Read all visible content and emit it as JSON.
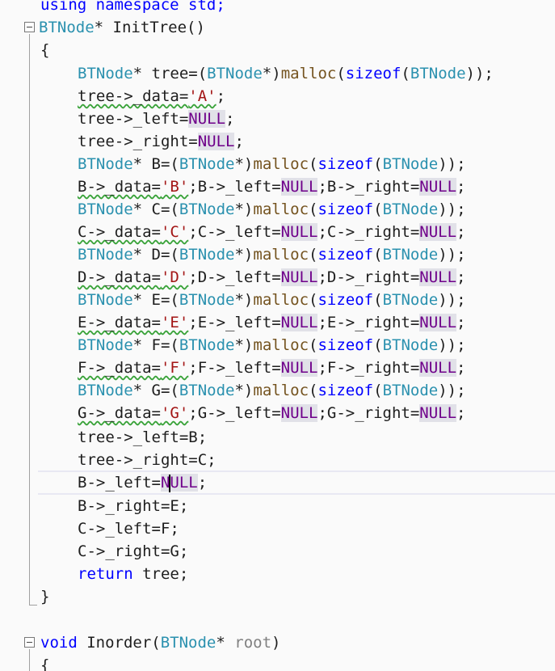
{
  "lines": {
    "l0": "using namespace std;",
    "l1_ty": "BTNode",
    "l1_rest": "* InitTree()",
    "l2": "{",
    "l3a": "BTNode",
    "l3b": "* tree=(",
    "l3c": "BTNode",
    "l3d": "*)",
    "l3e": "malloc",
    "l3f": "(",
    "l3g": "sizeof",
    "l3h": "(",
    "l3i": "BTNode",
    "l3j": "));",
    "l4a": "tree->_data=",
    "l4b": "'A'",
    "l4c": ";",
    "l5a": "tree->_left=",
    "l5b": "NULL",
    "l5c": ";",
    "l6a": "tree->_right=",
    "l6b": "NULL",
    "l6c": ";",
    "rows": [
      {
        "v": "B",
        "ch": "'B'"
      },
      {
        "v": "C",
        "ch": "'C'"
      },
      {
        "v": "D",
        "ch": "'D'"
      },
      {
        "v": "E",
        "ch": "'E'"
      },
      {
        "v": "F",
        "ch": "'F'"
      },
      {
        "v": "G",
        "ch": "'G'"
      }
    ],
    "t1": "tree->_left=B;",
    "t2": "tree->_right=C;",
    "t3a": "B->_left=",
    "t3b": "NULL",
    "t3c": ";",
    "t4": "B->_right=E;",
    "t5": "C->_left=F;",
    "t6": "C->_right=G;",
    "ret_kw": "return",
    "ret_rest": " tree;",
    "close": "}",
    "f2_kw": "void",
    "f2_name": " Inorder(",
    "f2_ty": "BTNode",
    "f2_rest": "* ",
    "f2_param": "root",
    "f2_close": ")",
    "open2": "{"
  },
  "colors": {
    "keyword": "#0000ff",
    "type": "#2b91af",
    "function": "#74531f",
    "string": "#a31515",
    "macro": "#6f008a"
  }
}
